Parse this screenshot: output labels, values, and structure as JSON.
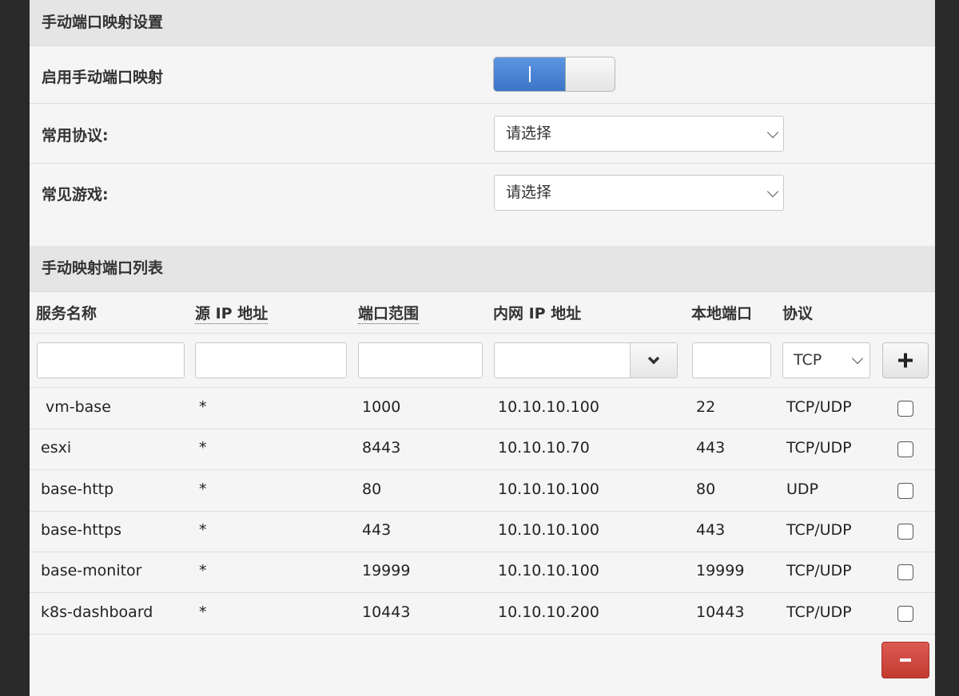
{
  "section1": {
    "title": "手动端口映射设置",
    "enable_label": "启用手动端口映射",
    "toggle_on": true,
    "protocol_label": "常用协议:",
    "protocol_value": "请选择",
    "game_label": "常见游戏:",
    "game_value": "请选择"
  },
  "section2": {
    "title": "手动映射端口列表",
    "headers": [
      "服务名称",
      "源 IP 地址",
      "端口范围",
      "内网 IP 地址",
      "本地端口",
      "协议"
    ],
    "new_row": {
      "protocol": "TCP"
    },
    "rows": [
      [
        "vm-base",
        "*",
        "1000",
        "10.10.10.100",
        "22",
        "TCP/UDP"
      ],
      [
        "esxi",
        "*",
        "8443",
        "10.10.10.70",
        "443",
        "TCP/UDP"
      ],
      [
        "base-http",
        "*",
        "80",
        "10.10.10.100",
        "80",
        "UDP"
      ],
      [
        "base-https",
        "*",
        "443",
        "10.10.10.100",
        "443",
        "TCP/UDP"
      ],
      [
        "base-monitor",
        "*",
        "19999",
        "10.10.10.100",
        "19999",
        "TCP/UDP"
      ],
      [
        "k8s-dashboard",
        "*",
        "10443",
        "10.10.10.200",
        "10443",
        "TCP/UDP"
      ]
    ]
  },
  "icons": {
    "add": "plus-icon",
    "remove": "minus-icon",
    "dropdown": "chevron-down-icon"
  },
  "colors": {
    "toggle_on": "#3a73c7",
    "remove_button": "#c9433a"
  }
}
